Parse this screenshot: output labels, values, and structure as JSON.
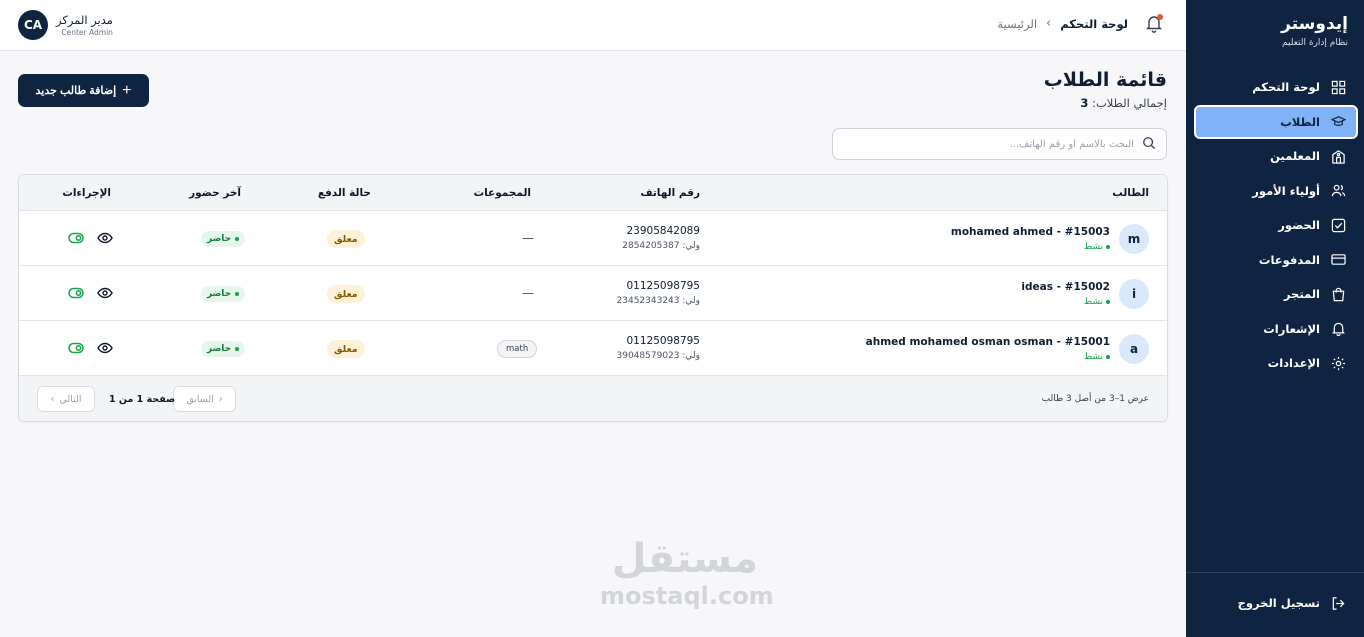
{
  "sidebar": {
    "brand_title": "إيدوستر",
    "brand_subtitle": "نظام إدارة التعليم",
    "items": [
      {
        "label": "لوحة التحكم",
        "icon": "grid-icon"
      },
      {
        "label": "الطلاب",
        "icon": "graduation-cap-icon",
        "active": true
      },
      {
        "label": "المعلمين",
        "icon": "building-icon"
      },
      {
        "label": "أولياء الأمور",
        "icon": "users-icon"
      },
      {
        "label": "الحضور",
        "icon": "check-square-icon"
      },
      {
        "label": "المدفوعات",
        "icon": "credit-card-icon"
      },
      {
        "label": "المتجر",
        "icon": "shopping-bag-icon"
      },
      {
        "label": "الإشعارات",
        "icon": "bell-icon"
      },
      {
        "label": "الإعدادات",
        "icon": "gear-icon"
      }
    ],
    "logout_label": "تسجيل الخروج"
  },
  "topbar": {
    "breadcrumb_current": "لوحة التحكم",
    "breadcrumb_home": "الرئيسية",
    "user_initials": "CA",
    "user_name": "مدير المركز",
    "user_role": "Center Admin"
  },
  "page": {
    "title": "قائمة الطلاب",
    "count_label": "إجمالي الطلاب:",
    "count_value": "3",
    "add_button_label": "إضافة طالب جديد"
  },
  "search": {
    "placeholder": "البحث بالاسم أو رقم الهاتف...",
    "value": ""
  },
  "table": {
    "columns": [
      "الطالب",
      "رقم الهاتف",
      "المجموعات",
      "حالة الدفع",
      "آخر حضور",
      "الإجراءات"
    ],
    "rows": [
      {
        "initial": "m",
        "name": "mohamed ahmed - #15003",
        "status": "نشط",
        "phone": "23905842089",
        "guardian_phone": "ولي: 2854205387",
        "groups": "—",
        "group_tag": "",
        "payment": "معلق",
        "attendance": "حاضر"
      },
      {
        "initial": "i",
        "name": "ideas - #15002",
        "status": "نشط",
        "phone": "01125098795",
        "guardian_phone": "ولي: 23452343243",
        "groups": "—",
        "group_tag": "",
        "payment": "معلق",
        "attendance": "حاضر"
      },
      {
        "initial": "a",
        "name": "ahmed mohamed osman osman - #15001",
        "status": "نشط",
        "phone": "01125098795",
        "guardian_phone": "ولي: 39048579023",
        "groups": "",
        "group_tag": "math",
        "payment": "معلق",
        "attendance": "حاضر"
      }
    ],
    "footer_info": "عرض 1–3 من أصل 3 طالب",
    "page_text": "صفحة 1 من 1",
    "prev_label": "السابق",
    "next_label": "التالي"
  },
  "watermark": {
    "arabic": "مستقل",
    "latin": "mostaql.com"
  },
  "colors": {
    "sidebar_bg": "#0f2440",
    "active_item": "#7fb2f7",
    "status_green": "#16a34a",
    "pending_bg": "#fdf2d8",
    "notification_dot": "#e2573d"
  }
}
